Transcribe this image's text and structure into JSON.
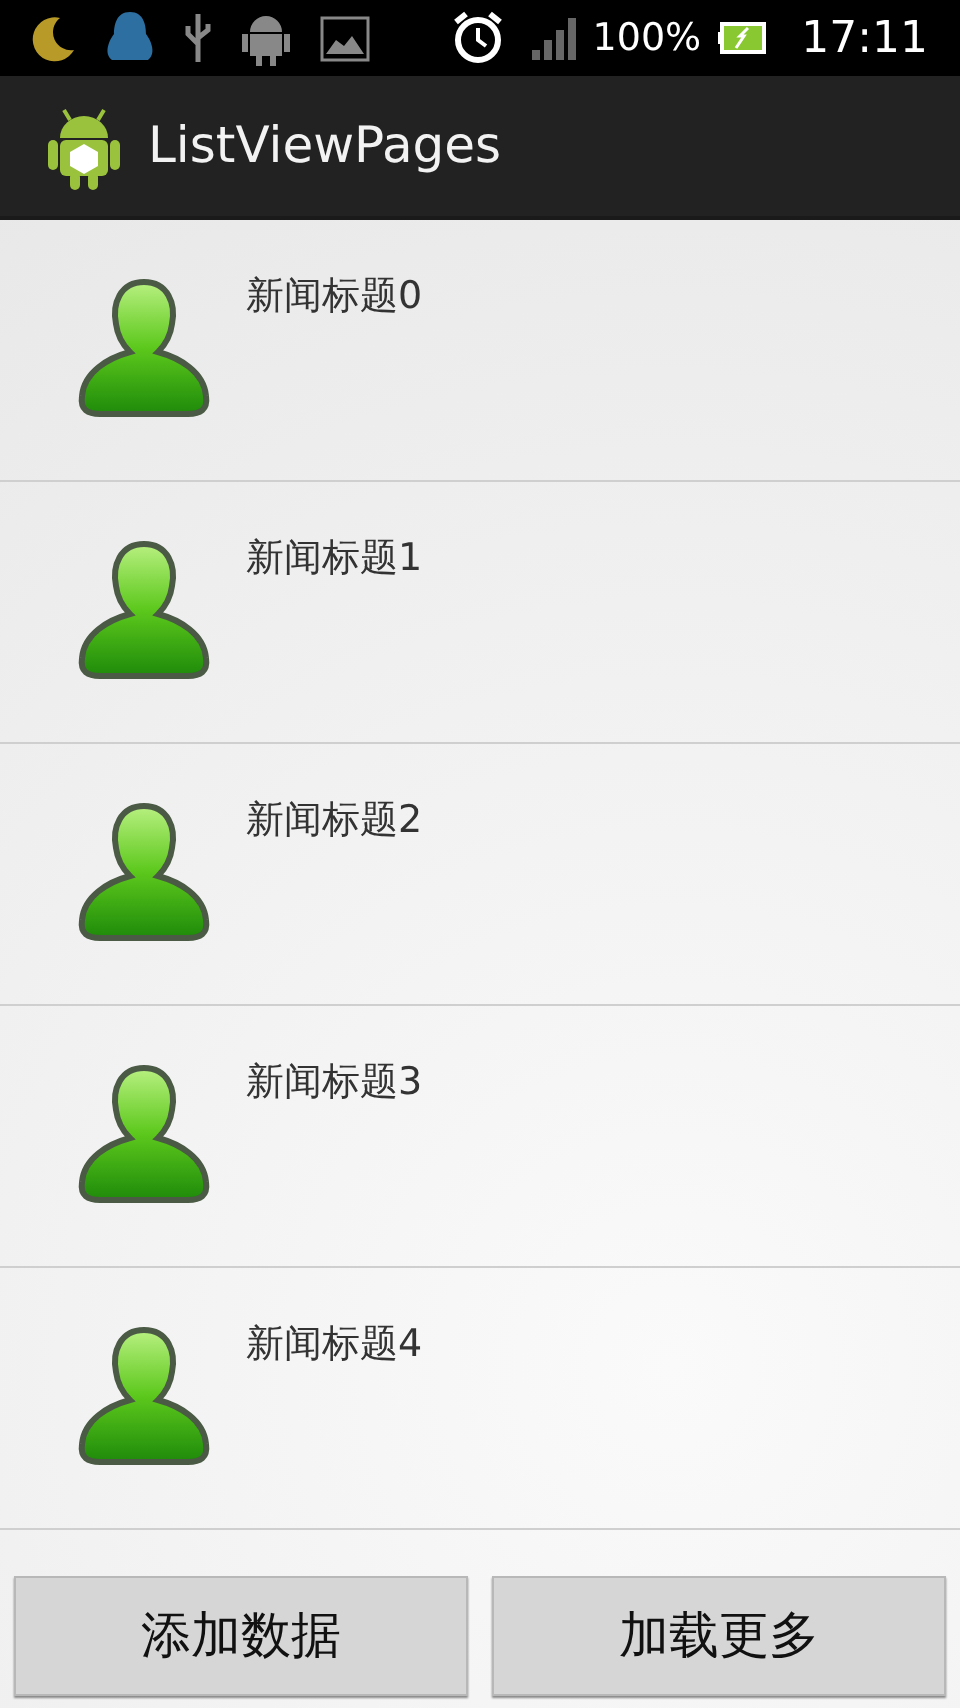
{
  "status_bar": {
    "battery": "100%",
    "time": "17:11"
  },
  "action_bar": {
    "title": "ListViewPages"
  },
  "list": [
    {
      "title": "新闻标题0"
    },
    {
      "title": "新闻标题1"
    },
    {
      "title": "新闻标题2"
    },
    {
      "title": "新闻标题3"
    },
    {
      "title": "新闻标题4"
    }
  ],
  "buttons": [
    "添加数据",
    "加载更多"
  ]
}
